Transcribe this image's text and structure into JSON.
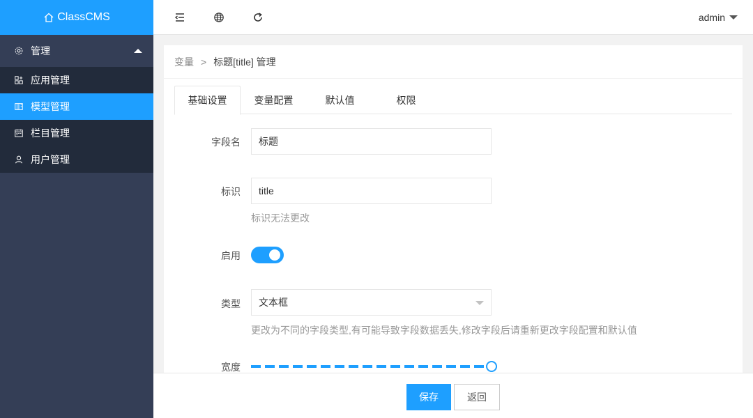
{
  "app": {
    "title": "ClassCMS"
  },
  "sidebar": {
    "group": {
      "label": "管理",
      "icon": "gear-icon"
    },
    "items": [
      {
        "label": "应用管理",
        "icon": "apps-icon",
        "active": false
      },
      {
        "label": "模型管理",
        "icon": "model-icon",
        "active": true
      },
      {
        "label": "栏目管理",
        "icon": "calendar-icon",
        "active": false
      },
      {
        "label": "用户管理",
        "icon": "user-icon",
        "active": false
      }
    ]
  },
  "header": {
    "icons": [
      "collapse-menu-icon",
      "globe-icon",
      "refresh-icon"
    ],
    "user": "admin"
  },
  "breadcrumb": {
    "parent": "变量",
    "separator": ">",
    "current": "标题[title] 管理"
  },
  "tabs": [
    "基础设置",
    "变量配置",
    "默认值",
    "权限"
  ],
  "form": {
    "field_name": {
      "label": "字段名",
      "value": "标题"
    },
    "identifier": {
      "label": "标识",
      "value": "title",
      "help": "标识无法更改"
    },
    "enabled": {
      "label": "启用",
      "on": true
    },
    "type": {
      "label": "类型",
      "value": "文本框",
      "help": "更改为不同的字段类型,有可能导致字段数据丢失,修改字段后请重新更改字段配置和默认值"
    },
    "width": {
      "label": "宽度",
      "value_fraction": 1.0
    }
  },
  "footer": {
    "save_label": "保存",
    "back_label": "返回"
  },
  "colors": {
    "accent": "#1e9fff",
    "sidebar": "#343e56",
    "sidebar_child": "#222b3b"
  }
}
